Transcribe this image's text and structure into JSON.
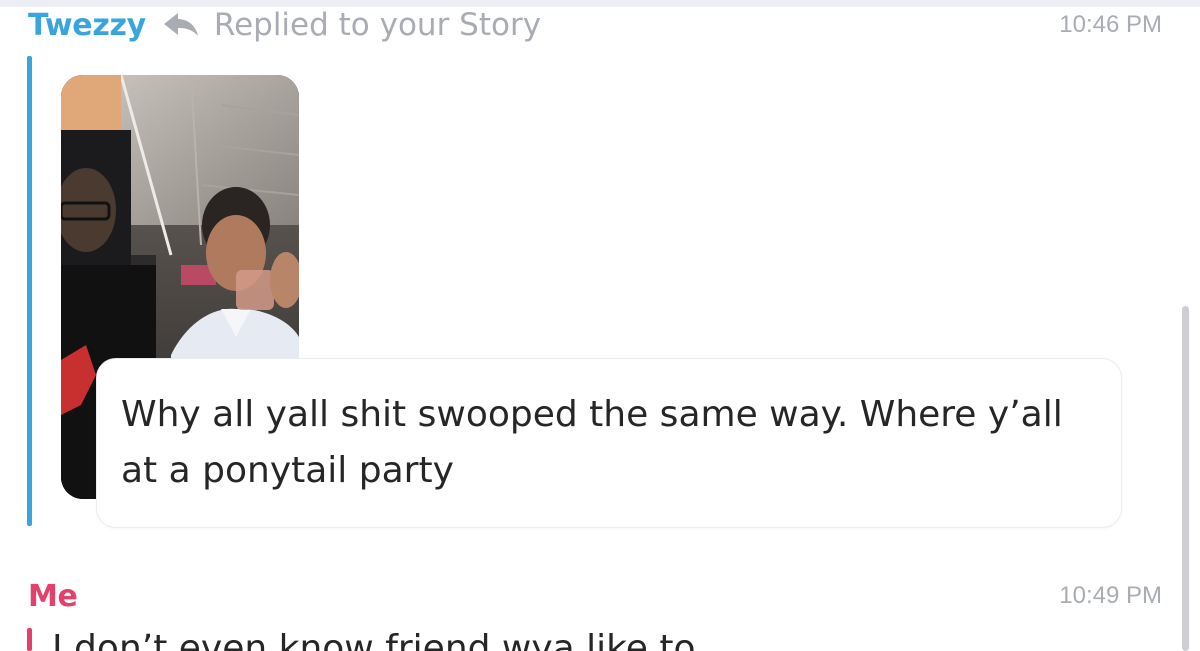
{
  "messages": [
    {
      "sender": "Twezzy",
      "sender_color": "#3aa5dd",
      "reply_label": "Replied to your Story",
      "timestamp": "10:46 PM",
      "text": "Why all yall shit swooped the same way. Where y’all at a ponytail party",
      "has_story_thumbnail": true
    },
    {
      "sender": "Me",
      "sender_color": "#e5406a",
      "timestamp": "10:49 PM",
      "text_partial": "I don’t even know friend wya like to..."
    }
  ],
  "colors": {
    "twezzy": "#3aa5dd",
    "me": "#e5406a",
    "meta_gray": "#a9adb3",
    "text": "#262626"
  },
  "icons": {
    "reply": "reply-arrow-icon"
  }
}
